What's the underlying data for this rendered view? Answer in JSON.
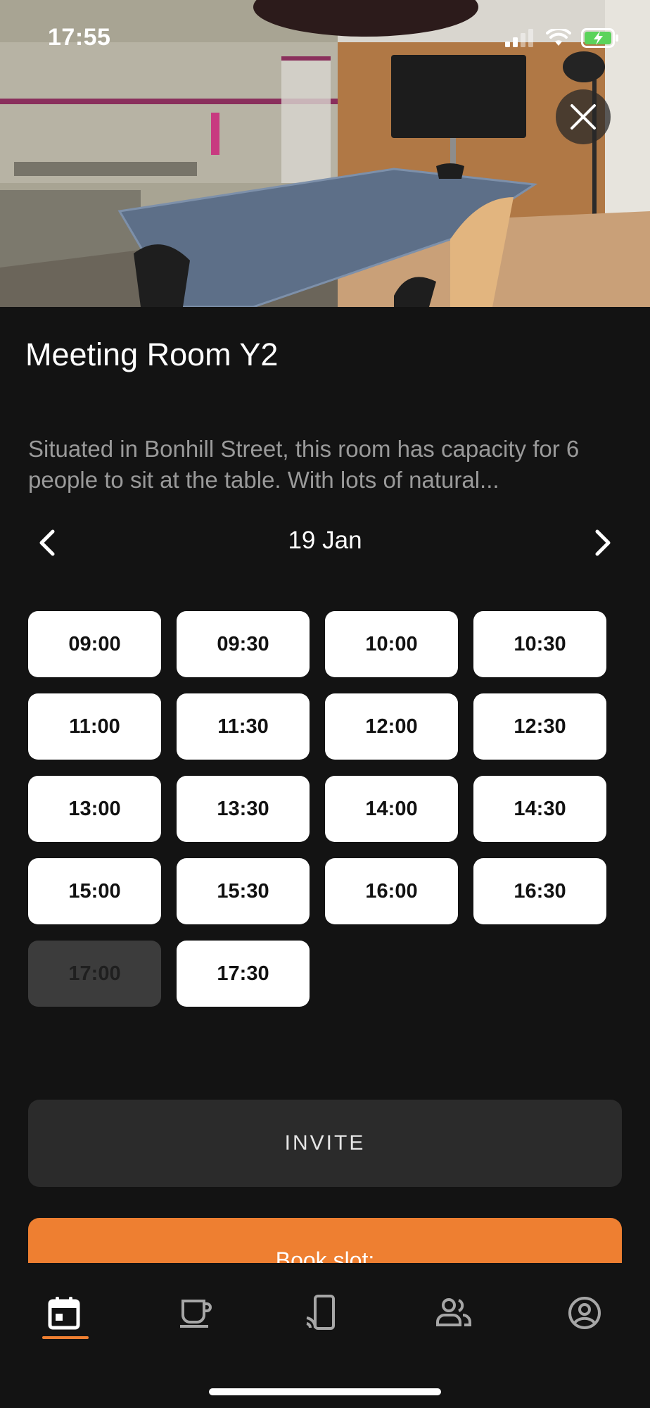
{
  "status_bar": {
    "time": "17:55"
  },
  "room": {
    "title": "Meeting Room Y2",
    "description": "Situated in Bonhill Street, this room  has capacity for 6 people to sit at the table. With lots of natural..."
  },
  "date_nav": {
    "date": "19 Jan"
  },
  "slots": [
    {
      "label": "09:00",
      "available": true
    },
    {
      "label": "09:30",
      "available": true
    },
    {
      "label": "10:00",
      "available": true
    },
    {
      "label": "10:30",
      "available": true
    },
    {
      "label": "11:00",
      "available": true
    },
    {
      "label": "11:30",
      "available": true
    },
    {
      "label": "12:00",
      "available": true
    },
    {
      "label": "12:30",
      "available": true
    },
    {
      "label": "13:00",
      "available": true
    },
    {
      "label": "13:30",
      "available": true
    },
    {
      "label": "14:00",
      "available": true
    },
    {
      "label": "14:30",
      "available": true
    },
    {
      "label": "15:00",
      "available": true
    },
    {
      "label": "15:30",
      "available": true
    },
    {
      "label": "16:00",
      "available": true
    },
    {
      "label": "16:30",
      "available": true
    },
    {
      "label": "17:00",
      "available": false
    },
    {
      "label": "17:30",
      "available": true
    }
  ],
  "actions": {
    "invite_label": "INVITE",
    "book_label": "Book slot:"
  },
  "tabs": [
    {
      "icon": "calendar-icon",
      "active": true
    },
    {
      "icon": "coffee-cup-icon",
      "active": false
    },
    {
      "icon": "phone-cast-icon",
      "active": false
    },
    {
      "icon": "people-icon",
      "active": false
    },
    {
      "icon": "account-circle-icon",
      "active": false
    }
  ],
  "colors": {
    "accent": "#ee7f31",
    "background": "#131313",
    "button_dark": "#2b2b2b",
    "slot_bg": "#ffffff",
    "slot_disabled": "#3c3c3c"
  }
}
